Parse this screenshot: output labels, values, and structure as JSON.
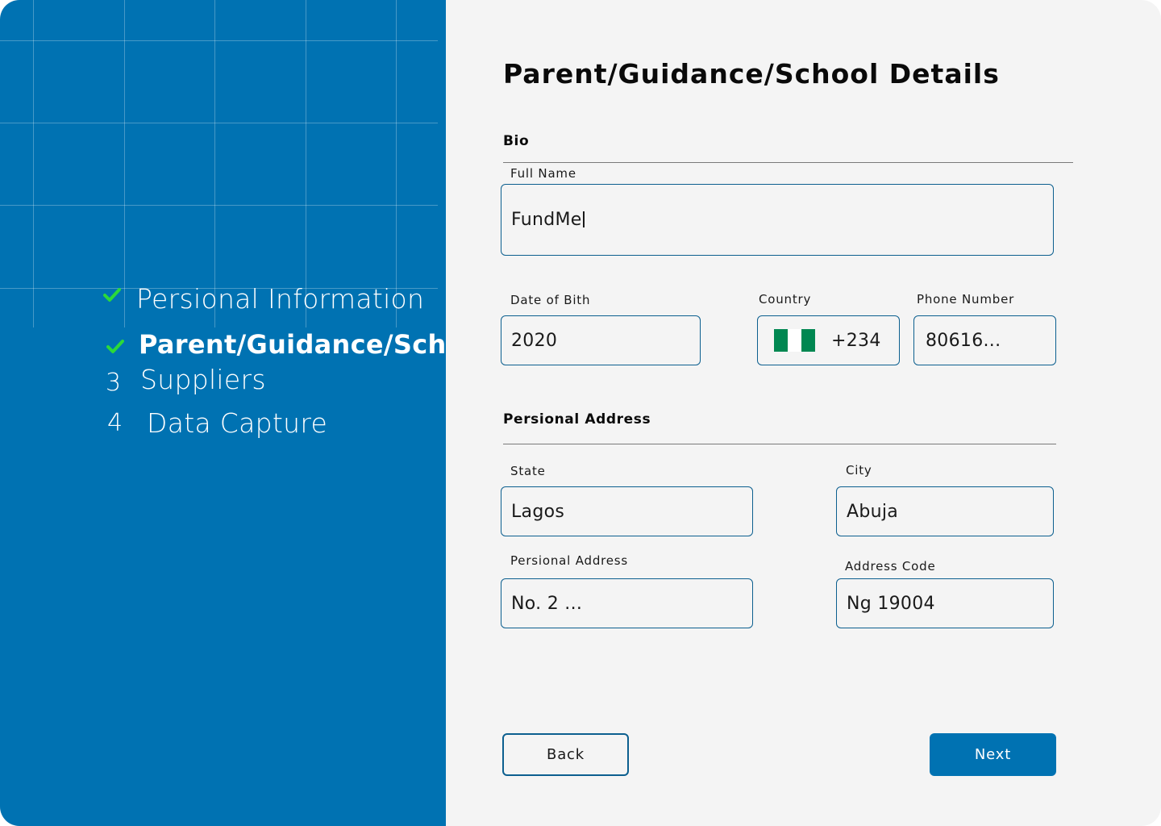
{
  "sidebar": {
    "steps": [
      {
        "marker": "check",
        "label": "Persional Information"
      },
      {
        "marker": "check",
        "label": "Parent/Guidance/School"
      },
      {
        "marker": "3",
        "label": "Suppliers"
      },
      {
        "marker": "4",
        "label": "Data Capture"
      }
    ],
    "check_color": "#2bd93a"
  },
  "page": {
    "title": "Parent/Guidance/School Details"
  },
  "bio": {
    "section_title": "Bio",
    "full_name": {
      "label": "Full Name",
      "value": "FundMe"
    },
    "dob": {
      "label": "Date of Bith",
      "value": "2020"
    },
    "country": {
      "label": "Country",
      "code": "+234",
      "flag_colors": [
        "#008751",
        "#ffffff",
        "#008751"
      ]
    },
    "phone": {
      "label": "Phone Number",
      "value": "80616..."
    }
  },
  "address": {
    "section_title": "Persional Address",
    "state": {
      "label": "State",
      "value": "Lagos"
    },
    "city": {
      "label": "City",
      "value": "Abuja"
    },
    "personal_address": {
      "label": "Persional Address",
      "value": "No. 2 ..."
    },
    "address_code": {
      "label": "Address Code",
      "value": "Ng 19004"
    }
  },
  "actions": {
    "back_label": "Back",
    "next_label": "Next"
  },
  "colors": {
    "primary": "#0072b2",
    "border": "#0c5f8f",
    "background": "#f4f4f4"
  }
}
